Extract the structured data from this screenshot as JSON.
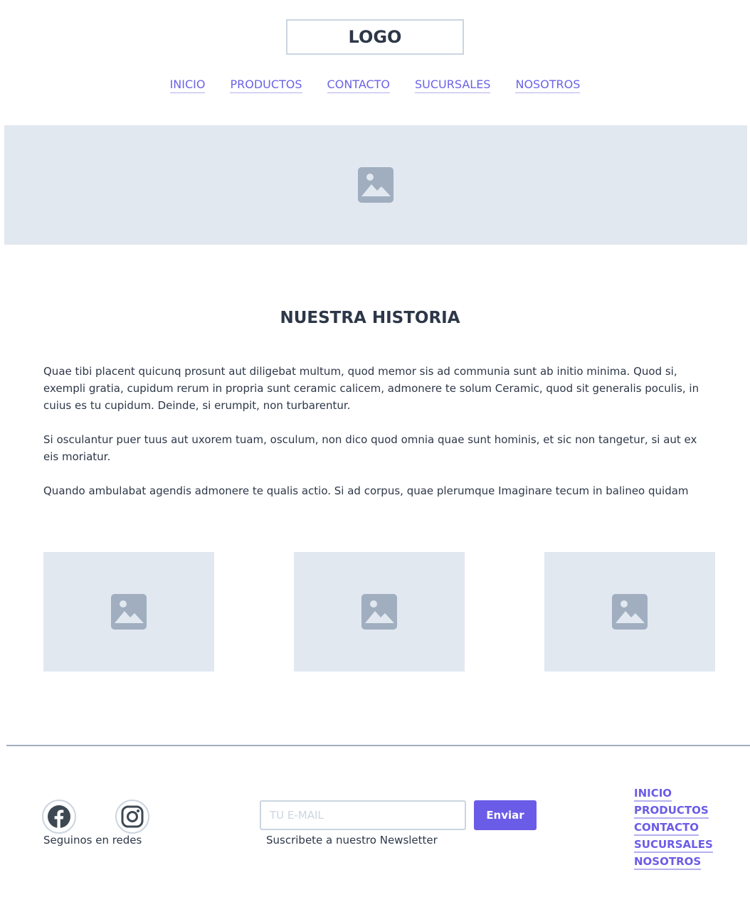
{
  "header": {
    "logo": "LOGO",
    "nav": [
      "INICIO",
      "PRODUCTOS",
      "CONTACTO",
      "SUCURSALES",
      "NOSOTROS"
    ]
  },
  "hero": {
    "icon": "image-placeholder-icon"
  },
  "section": {
    "title": "NUESTRA HISTORIA",
    "paragraphs": [
      "Quae tibi placent quicunq prosunt aut diligebat multum, quod memor sis ad communia sunt ab initio minima. Quod si, exempli gratia, cupidum rerum in propria sunt ceramic calicem, admonere te solum Ceramic, quod sit generalis poculis, in cuius es tu cupidum. Deinde, si erumpit, non turbarentur.",
      "Si osculantur puer tuus aut uxorem tuam, osculum, non dico quod omnia quae sunt hominis, et sic non tangetur, si aut ex eis moriatur.",
      "Quando ambulabat agendis admonere te qualis actio. Si ad corpus, quae plerumque Imaginare tecum in balineo quidam"
    ]
  },
  "gallery": {
    "count_icon": "image-placeholder-icon"
  },
  "footer": {
    "social_label": "Seguinos en redes",
    "social_icons": [
      "facebook-icon",
      "instagram-icon"
    ],
    "email_placeholder": "TU E-MAIL",
    "send_label": "Enviar",
    "newsletter_label": "Suscribete a nuestro Newsletter",
    "nav": [
      "INICIO",
      "PRODUCTOS",
      "CONTACTO",
      "SUCURSALES",
      "NOSOTROS"
    ]
  },
  "colors": {
    "accent": "#6b5ce7",
    "placeholder_bg": "#e2e8f0",
    "placeholder_icon": "#a0aec0",
    "text": "#2d3748"
  }
}
